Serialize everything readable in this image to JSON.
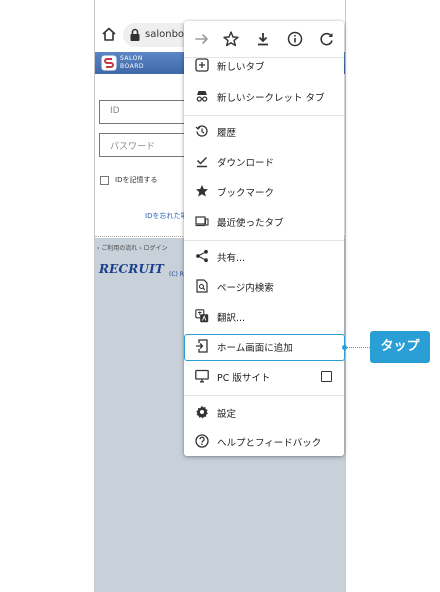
{
  "browser": {
    "url": "salonboa"
  },
  "site": {
    "logo_text_line1": "SALON",
    "logo_text_line2": "BOARD",
    "id_placeholder": "ID",
    "password_placeholder": "パスワード",
    "remember_label": "IDを記憶する",
    "forgot_link": "IDを忘れた場",
    "footer_links": "› ご利用の流れ  › ログイン",
    "recruit_logo": "RECRUIT",
    "copyright": "(C) R"
  },
  "menu": {
    "items": [
      {
        "label": "新しいタブ",
        "icon": "plus-square-icon"
      },
      {
        "label": "新しいシークレット タブ",
        "icon": "incognito-icon"
      },
      {
        "label": "履歴",
        "icon": "history-icon"
      },
      {
        "label": "ダウンロード",
        "icon": "download-check-icon"
      },
      {
        "label": "ブックマーク",
        "icon": "star-filled-icon"
      },
      {
        "label": "最近使ったタブ",
        "icon": "recent-tabs-icon"
      },
      {
        "label": "共有...",
        "icon": "share-icon"
      },
      {
        "label": "ページ内検索",
        "icon": "find-in-page-icon"
      },
      {
        "label": "翻訳...",
        "icon": "translate-icon"
      },
      {
        "label": "ホーム画面に追加",
        "icon": "add-to-home-icon"
      },
      {
        "label": "PC 版サイト",
        "icon": "desktop-icon"
      },
      {
        "label": "設定",
        "icon": "gear-icon"
      },
      {
        "label": "ヘルプとフィードバック",
        "icon": "help-icon"
      }
    ]
  },
  "callout": {
    "label": "タップ",
    "color": "#2a9fd6"
  }
}
